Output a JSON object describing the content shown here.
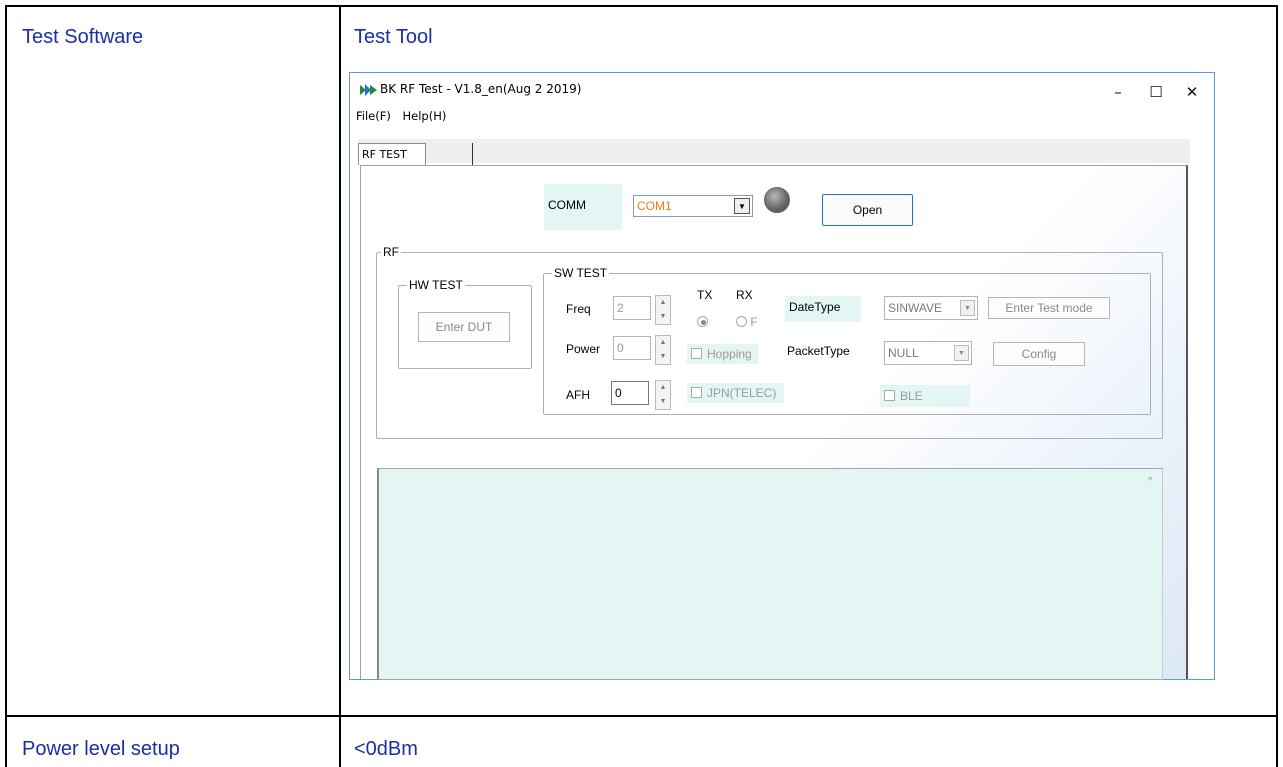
{
  "table": {
    "row1_left": "Test Software",
    "row1_right": "Test Tool",
    "row2_left": "Power level setup",
    "row2_right": "<0dBm"
  },
  "window": {
    "title": "BK RF Test - V1.8_en(Aug  2 2019)",
    "minimize": "–",
    "maximize": "☐",
    "close": "✕",
    "menu": [
      "File(F)",
      "Help(H)"
    ],
    "tabs": [
      "RF TEST",
      ""
    ],
    "comm": {
      "label": "COMM",
      "port": "COM1",
      "open_button": "Open"
    },
    "rf_group": {
      "caption": "RF",
      "hw_test": {
        "caption": "HW TEST",
        "button": "Enter DUT"
      },
      "sw_test": {
        "caption": "SW TEST",
        "freq_label": "Freq",
        "freq_value": "2",
        "power_label": "Power",
        "power_value": "0",
        "afh_label": "AFH",
        "afh_value": "0",
        "tx_label": "TX",
        "rx_label": "RX",
        "rx_option_text": "F",
        "hopping_label": "Hopping",
        "jpn_label": "JPN(TELEC)",
        "datetype_label": "DateType",
        "datetype_value": "SINWAVE",
        "packettype_label": "PacketType",
        "packettype_value": "NULL",
        "enter_test_mode": "Enter Test mode",
        "config": "Config",
        "ble_label": "BLE"
      }
    },
    "log_scroll_up": "^"
  },
  "colors": {
    "doc_text": "#1a2ea8",
    "window_border": "#5d9ad6",
    "teal_bg": "#e3f6f4",
    "com_text": "#e8830a"
  }
}
